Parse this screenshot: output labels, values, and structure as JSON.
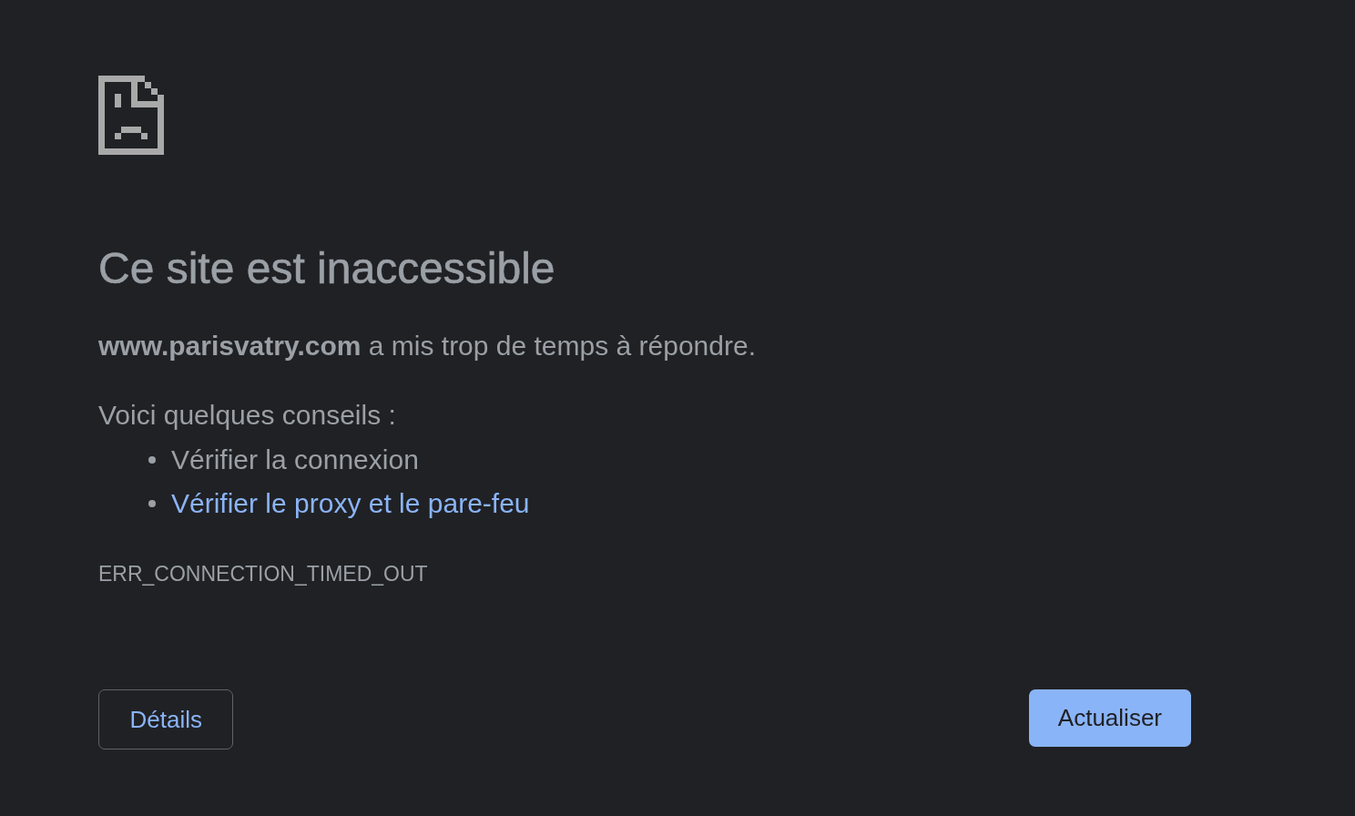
{
  "heading": "Ce site est inaccessible",
  "message": "**www.parisvatry.com** a mis trop de temps à répondre.",
  "suggestions": {
    "intro": "Voici quelques conseils :",
    "items": [
      {
        "text": "Vérifier la connexion",
        "kind": "text"
      },
      {
        "text": "Vérifier le proxy et le pare-feu",
        "kind": "link"
      }
    ]
  },
  "error_code": "ERR_CONNECTION_TIMED_OUT",
  "buttons": [
    {
      "label": "Détails",
      "kind": "secondary"
    },
    {
      "label": "Actualiser",
      "kind": "primary"
    }
  ]
}
